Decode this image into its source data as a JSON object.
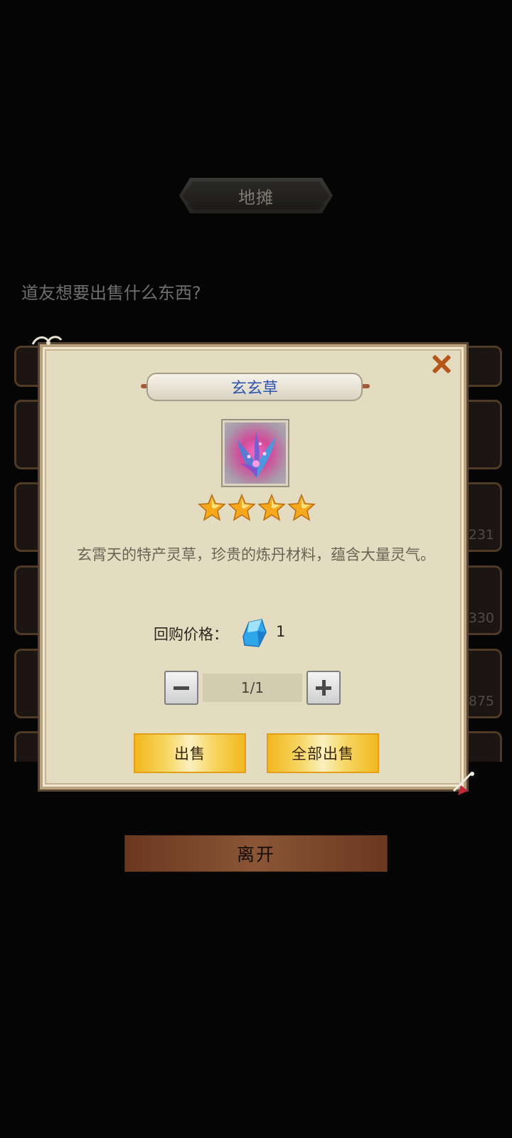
{
  "header": {
    "title": "地摊"
  },
  "prompt_text": "道友想要出售什么东西?",
  "background_list": {
    "visible_counts": [
      "231",
      "330",
      "875"
    ]
  },
  "dialog": {
    "item_name": "玄玄草",
    "rarity_stars": 4,
    "description": "玄霄天的特产灵草，珍贵的炼丹材料，蕴含大量灵气。",
    "price_label": "回购价格：",
    "price_value": "1",
    "currency_icon": "blue-crystal-icon",
    "quantity_display": "1/1",
    "sell_label": "出售",
    "sell_all_label": "全部出售",
    "close_icon": "close-icon"
  },
  "leave_label": "离开",
  "colors": {
    "background": "#050505",
    "dialog_bg": "#e4dcc0",
    "item_name": "#2f55b0",
    "close": "#b5561b",
    "gold_button": "#f2b81e",
    "leave_button": "#8a5636"
  }
}
